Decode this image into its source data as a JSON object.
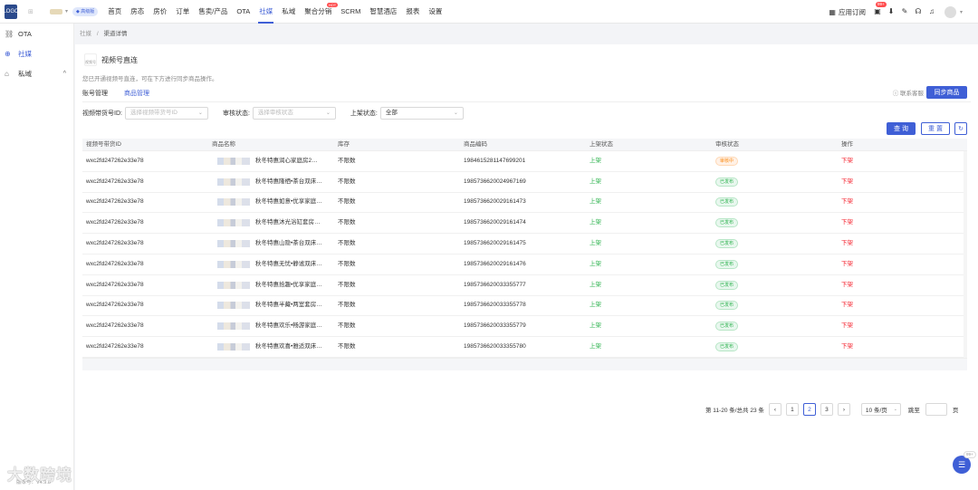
{
  "topbar": {
    "logo_text": "LOGO",
    "vip_label": "高级版",
    "nav": [
      {
        "label": "首页"
      },
      {
        "label": "房态"
      },
      {
        "label": "房价"
      },
      {
        "label": "订单"
      },
      {
        "label": "售卖/产品"
      },
      {
        "label": "OTA"
      },
      {
        "label": "社媒"
      },
      {
        "label": "私域"
      },
      {
        "label": "聚合分销"
      },
      {
        "label": "SCRM"
      },
      {
        "label": "智慧酒店"
      },
      {
        "label": "报表"
      },
      {
        "label": "设置"
      }
    ],
    "active_nav": "社媒",
    "hot_label": "HOT",
    "apps_label": "应用订阅",
    "notify_badge": "99+"
  },
  "sidebar": {
    "items": [
      {
        "label": "OTA",
        "icon": "ota-icon"
      },
      {
        "label": "社媒",
        "icon": "globe-icon"
      },
      {
        "label": "私域",
        "icon": "store-icon"
      }
    ],
    "active": "社媒",
    "version": "版本号：V4.9.8",
    "watermark": "大数跨境"
  },
  "breadcrumb": {
    "root": "社媒",
    "sep": "/",
    "current": "渠道详情"
  },
  "product": {
    "logo_text": "视频号",
    "title": "视频号直连",
    "desc": "您已开通视频号直连，可在下方进行同步商品操作。",
    "tabs": [
      "账号管理",
      "商品管理"
    ],
    "active_tab": "商品管理",
    "support": "联系客服",
    "sync_button": "同步商品"
  },
  "filters": {
    "shop_id_label": "视频带货号ID:",
    "shop_id_placeholder": "选择视频带货号ID",
    "audit_label": "审核状态:",
    "audit_placeholder": "选择审核状态",
    "listing_label": "上架状态:",
    "listing_value": "全部",
    "query_button": "查 询",
    "reset_button": "重 置"
  },
  "table": {
    "headers": [
      "视频号带货ID",
      "商品名称",
      "库存",
      "商品编码",
      "上架状态",
      "审核状态",
      "操作"
    ],
    "rows": [
      {
        "id": "wxc2fd247262e33e78",
        "name": "秋冬特惠润心家庭房2…",
        "stock": "不限数",
        "code": "1984615281147699201",
        "listing": "上架",
        "audit": "审核中",
        "audit_type": "pending",
        "action": "下架"
      },
      {
        "id": "wxc2fd247262e33e78",
        "name": "秋冬特惠隆栖•茶台双床…",
        "stock": "不限数",
        "code": "1985736620024967169",
        "listing": "上架",
        "audit": "已发布",
        "audit_type": "ok",
        "action": "下架"
      },
      {
        "id": "wxc2fd247262e33e78",
        "name": "秋冬特惠如意•优享家庭…",
        "stock": "不限数",
        "code": "1985736620029161473",
        "listing": "上架",
        "audit": "已发布",
        "audit_type": "ok",
        "action": "下架"
      },
      {
        "id": "wxc2fd247262e33e78",
        "name": "秋冬特惠沐光浴缸套房…",
        "stock": "不限数",
        "code": "1985736620029161474",
        "listing": "上架",
        "audit": "已发布",
        "audit_type": "ok",
        "action": "下架"
      },
      {
        "id": "wxc2fd247262e33e78",
        "name": "秋冬特惠山隐•茶台双床…",
        "stock": "不限数",
        "code": "1985736620029161475",
        "listing": "上架",
        "audit": "已发布",
        "audit_type": "ok",
        "action": "下架"
      },
      {
        "id": "wxc2fd247262e33e78",
        "name": "秋冬特惠无忧•静谧双床…",
        "stock": "不限数",
        "code": "1985736620029161476",
        "listing": "上架",
        "audit": "已发布",
        "audit_type": "ok",
        "action": "下架"
      },
      {
        "id": "wxc2fd247262e33e78",
        "name": "秋冬特惠拾趣•优享家庭…",
        "stock": "不限数",
        "code": "1985736620033355777",
        "listing": "上架",
        "audit": "已发布",
        "audit_type": "ok",
        "action": "下架"
      },
      {
        "id": "wxc2fd247262e33e78",
        "name": "秋冬特惠半藏•两室套房…",
        "stock": "不限数",
        "code": "1985736620033355778",
        "listing": "上架",
        "audit": "已发布",
        "audit_type": "ok",
        "action": "下架"
      },
      {
        "id": "wxc2fd247262e33e78",
        "name": "秋冬特惠欢乐•畅游家庭…",
        "stock": "不限数",
        "code": "1985736620033355779",
        "listing": "上架",
        "audit": "已发布",
        "audit_type": "ok",
        "action": "下架"
      },
      {
        "id": "wxc2fd247262e33e78",
        "name": "秋冬特惠欢喜•雅适双床…",
        "stock": "不限数",
        "code": "1985736620033355780",
        "listing": "上架",
        "audit": "已发布",
        "audit_type": "ok",
        "action": "下架"
      }
    ]
  },
  "pagination": {
    "summary": "第 11-20 条/总共 23 条",
    "pages": [
      "1",
      "2",
      "3"
    ],
    "current": "2",
    "page_size": "10 条/页",
    "goto_label": "跳至",
    "page_unit": "页"
  },
  "chat": {
    "badge": "99+"
  },
  "colors": {
    "accent": "#3f5fd6",
    "success": "#2bb24c",
    "danger": "#f5222d",
    "warning": "#fa8c16"
  }
}
